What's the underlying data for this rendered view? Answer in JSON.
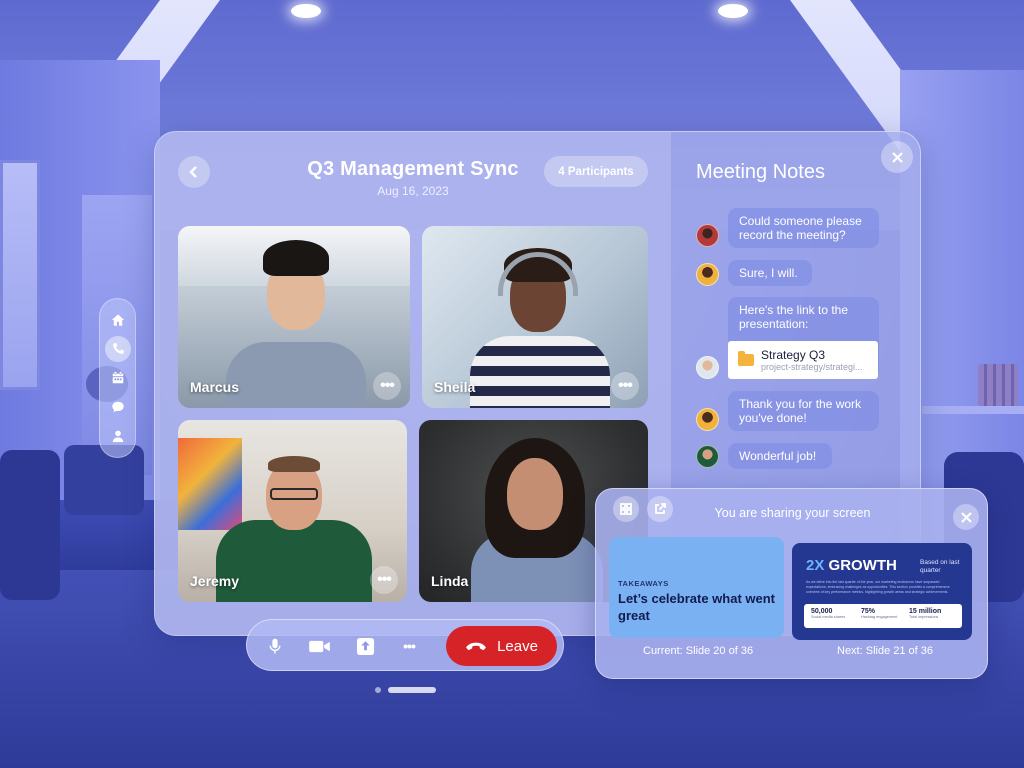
{
  "meeting": {
    "title": "Q3 Management Sync",
    "date": "Aug 16, 2023",
    "participants_label": "4 Participants"
  },
  "side_rail": {
    "items": [
      {
        "icon": "home-icon",
        "active": false
      },
      {
        "icon": "phone-icon",
        "active": true
      },
      {
        "icon": "calendar-icon",
        "active": false
      },
      {
        "icon": "chat-icon",
        "active": false
      },
      {
        "icon": "profile-icon",
        "active": false
      }
    ]
  },
  "participants": [
    {
      "name": "Marcus"
    },
    {
      "name": "Sheila"
    },
    {
      "name": "Jeremy"
    },
    {
      "name": "Linda"
    }
  ],
  "notes": {
    "title": "Meeting Notes",
    "messages": [
      {
        "text": "Could someone please record the meeting?"
      },
      {
        "text": "Sure, I will."
      },
      {
        "text": "Here's the link to the presentation:"
      },
      {
        "text": "Thank you for the work you've done!"
      },
      {
        "text": "Wonderful job!"
      }
    ],
    "attachment": {
      "name": "Strategy Q3",
      "path": "project-strategy/strategi..."
    }
  },
  "controls": {
    "leave_label": "Leave",
    "more_label": "•••",
    "icons": [
      "microphone-icon",
      "camera-icon",
      "share-screen-icon",
      "more-icon",
      "hang-up-icon"
    ]
  },
  "share": {
    "title": "You are sharing your screen",
    "current_caption": "Current: Slide 20 of 36",
    "next_caption": "Next: Slide 21 of 36",
    "current_slide": {
      "label": "TAKEAWAYS",
      "headline": "Let’s celebrate what went great"
    },
    "next_slide": {
      "title_accent": "2X",
      "title_rest": " GROWTH",
      "based_on": "Based on last quarter",
      "paragraph": "As we delve into the last quarter of the year, our marketing endeavors have surpassed expectations, embracing challenges as opportunities. This section provides a comprehensive overview of key performance metrics, highlighting growth areas and strategic achievements.",
      "stats": [
        {
          "value": "50,000",
          "label": "Social media shares"
        },
        {
          "value": "75%",
          "label": "Hashtag engagement"
        },
        {
          "value": "15 million",
          "label": "Total impressions"
        }
      ]
    }
  },
  "colors": {
    "leave": "#d62328",
    "accent_blue": "#7ab1f2",
    "slide_navy": "#243791"
  }
}
